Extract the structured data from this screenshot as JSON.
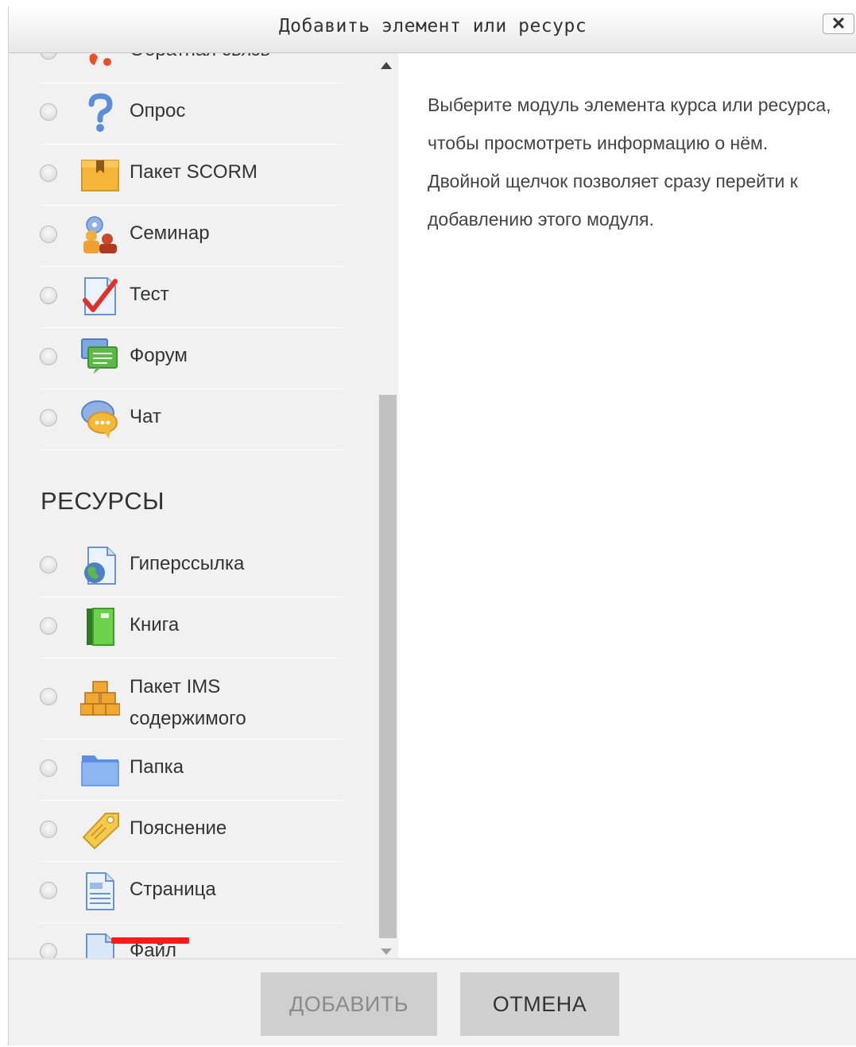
{
  "dialog": {
    "title": "Добавить элемент или ресурс",
    "close_label": "✕"
  },
  "activities": [
    {
      "label": "Обратная связь",
      "icon": "feedback-icon"
    },
    {
      "label": "Опрос",
      "icon": "question-icon"
    },
    {
      "label": "Пакет SCORM",
      "icon": "scorm-package-icon"
    },
    {
      "label": "Семинар",
      "icon": "workshop-icon"
    },
    {
      "label": "Тест",
      "icon": "quiz-icon"
    },
    {
      "label": "Форум",
      "icon": "forum-icon"
    },
    {
      "label": "Чат",
      "icon": "chat-icon"
    }
  ],
  "resources_heading": "РЕСУРСЫ",
  "resources": [
    {
      "label": "Гиперссылка",
      "icon": "url-icon"
    },
    {
      "label": "Книга",
      "icon": "book-icon"
    },
    {
      "label": "Пакет IMS содержимого",
      "icon": "ims-package-icon"
    },
    {
      "label": "Папка",
      "icon": "folder-icon"
    },
    {
      "label": "Пояснение",
      "icon": "label-icon"
    },
    {
      "label": "Страница",
      "icon": "page-icon"
    },
    {
      "label": "Файл",
      "icon": "file-icon"
    }
  ],
  "help_text": "Выберите модуль элемента курса или ресурса, чтобы просмотреть информацию о нём. Двойной щелчок позволяет сразу перейти к добавлению этого модуля.",
  "buttons": {
    "add": "ДОБАВИТЬ",
    "cancel": "ОТМЕНА"
  },
  "colors": {
    "annotation_underline": "#ff1a1a"
  }
}
